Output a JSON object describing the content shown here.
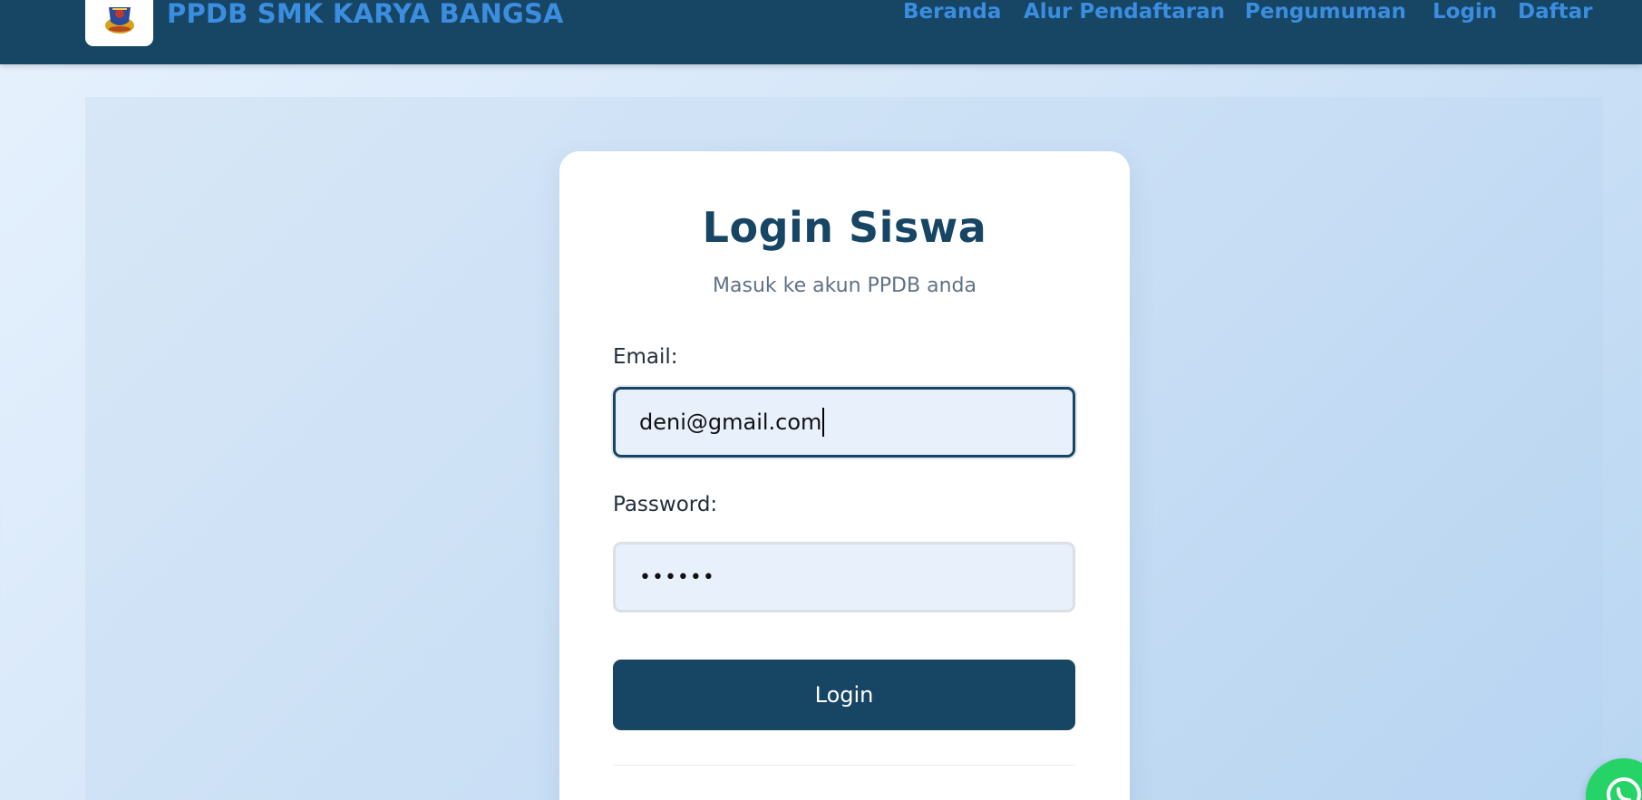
{
  "header": {
    "brand": "PPDB SMK KARYA BANGSA",
    "logo": "school-crest-icon",
    "nav": [
      {
        "label": "Beranda"
      },
      {
        "label": "Alur Pendaftaran"
      },
      {
        "label": "Pengumuman"
      },
      {
        "label": "Login"
      },
      {
        "label": "Daftar"
      }
    ]
  },
  "login_card": {
    "title": "Login Siswa",
    "subtitle": "Masuk ke akun PPDB anda",
    "email_label": "Email:",
    "email_value": "deni@gmail.com",
    "password_label": "Password:",
    "password_value": "••••••",
    "submit_label": "Login"
  },
  "floating": {
    "whatsapp_icon": "whatsapp-icon"
  },
  "colors": {
    "primary": "#174564",
    "link": "#3a8ddf",
    "input_bg": "#e8f0fc",
    "whatsapp": "#25d366"
  }
}
